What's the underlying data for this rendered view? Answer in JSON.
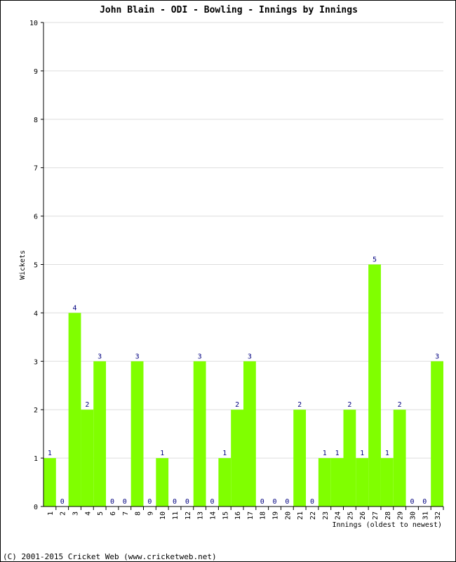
{
  "chart_data": {
    "type": "bar",
    "title": "John Blain - ODI - Bowling - Innings by Innings",
    "xlabel": "Innings (oldest to newest)",
    "ylabel": "Wickets",
    "ylim": [
      0,
      10
    ],
    "yticks": [
      0,
      1,
      2,
      3,
      4,
      5,
      6,
      7,
      8,
      9,
      10
    ],
    "grid": true,
    "categories": [
      "1",
      "2",
      "3",
      "4",
      "5",
      "6",
      "7",
      "8",
      "9",
      "10",
      "11",
      "12",
      "13",
      "14",
      "15",
      "16",
      "17",
      "18",
      "19",
      "20",
      "21",
      "22",
      "23",
      "24",
      "25",
      "26",
      "27",
      "28",
      "29",
      "30",
      "31",
      "32"
    ],
    "values": [
      1,
      0,
      4,
      2,
      3,
      0,
      0,
      3,
      0,
      1,
      0,
      0,
      3,
      0,
      1,
      2,
      3,
      0,
      0,
      0,
      2,
      0,
      1,
      1,
      2,
      1,
      5,
      1,
      2,
      0,
      0,
      3
    ],
    "bar_color": "#80ff00",
    "label_color": "#000080"
  },
  "footer": "(C) 2001-2015 Cricket Web (www.cricketweb.net)"
}
